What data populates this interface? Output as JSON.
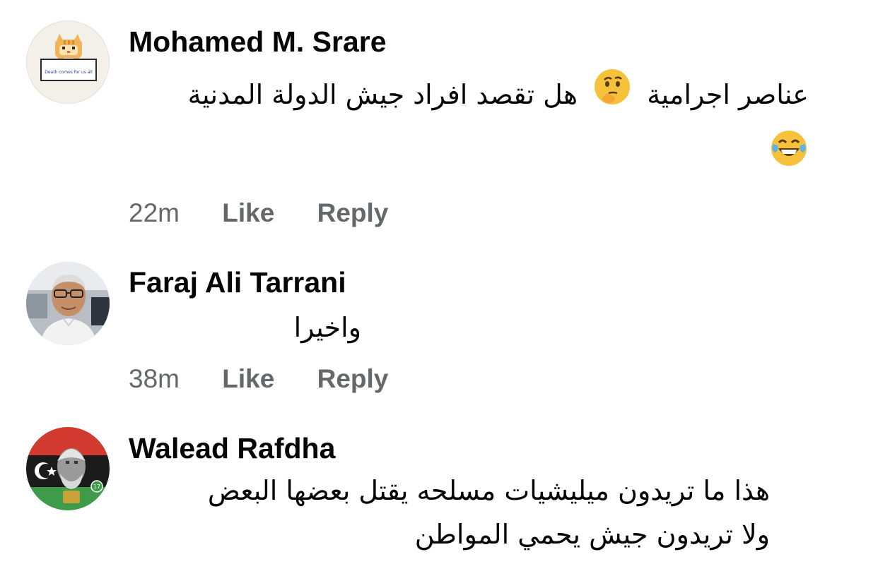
{
  "comments": [
    {
      "author": "Mohamed M. Srare",
      "avatar_caption": "Death comes for us all",
      "text_lines": [
        {
          "before": "هل تقصد افراد جيش الدولة المدنية",
          "emoji": "thinking-face",
          "after": "عناصر اجرامية"
        },
        {
          "before": "",
          "emoji": "tears-of-joy-face",
          "after": ""
        }
      ],
      "time": "22m",
      "like_label": "Like",
      "reply_label": "Reply"
    },
    {
      "author": "Faraj Ali Tarrani",
      "text_lines": [
        "واخيرا"
      ],
      "time": "38m",
      "like_label": "Like",
      "reply_label": "Reply"
    },
    {
      "author": "Walead Rafdha",
      "avatar_badge": "17",
      "text_lines": [
        "هذا ما تريدون ميليشيات مسلحه يقتل بعضها البعض",
        "ولا تريدون جيش يحمي المواطن"
      ]
    }
  ],
  "colors": {
    "name": "#050505",
    "meta": "#65676b",
    "background": "#ffffff"
  }
}
